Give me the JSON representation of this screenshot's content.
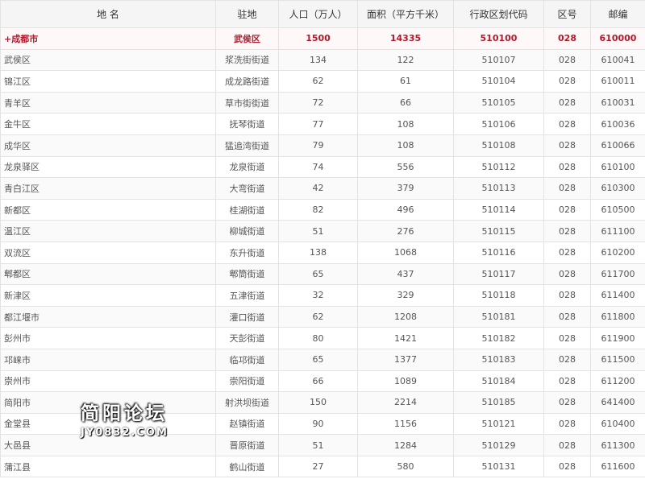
{
  "headers": [
    "地 名",
    "驻地",
    "人口（万人）",
    "面积（平方千米）",
    "行政区划代码",
    "区号",
    "邮编"
  ],
  "rows": [
    [
      "+成都市",
      "武侯区",
      "1500",
      "14335",
      "510100",
      "028",
      "610000"
    ],
    [
      "武侯区",
      "浆洗街街道",
      "134",
      "122",
      "510107",
      "028",
      "610041"
    ],
    [
      "锦江区",
      "成龙路街道",
      "62",
      "61",
      "510104",
      "028",
      "610011"
    ],
    [
      "青羊区",
      "草市街街道",
      "72",
      "66",
      "510105",
      "028",
      "610031"
    ],
    [
      "金牛区",
      "抚琴街道",
      "77",
      "108",
      "510106",
      "028",
      "610036"
    ],
    [
      "成华区",
      "猛追湾街道",
      "79",
      "108",
      "510108",
      "028",
      "610066"
    ],
    [
      "龙泉驿区",
      "龙泉街道",
      "74",
      "556",
      "510112",
      "028",
      "610100"
    ],
    [
      "青白江区",
      "大弯街道",
      "42",
      "379",
      "510113",
      "028",
      "610300"
    ],
    [
      "新都区",
      "桂湖街道",
      "82",
      "496",
      "510114",
      "028",
      "610500"
    ],
    [
      "温江区",
      "柳城街道",
      "51",
      "276",
      "510115",
      "028",
      "611100"
    ],
    [
      "双流区",
      "东升街道",
      "138",
      "1068",
      "510116",
      "028",
      "610200"
    ],
    [
      "郫都区",
      "郫筒街道",
      "65",
      "437",
      "510117",
      "028",
      "611700"
    ],
    [
      "新津区",
      "五津街道",
      "32",
      "329",
      "510118",
      "028",
      "611400"
    ],
    [
      "都江堰市",
      "灌口街道",
      "62",
      "1208",
      "510181",
      "028",
      "611800"
    ],
    [
      "彭州市",
      "天彭街道",
      "80",
      "1421",
      "510182",
      "028",
      "611900"
    ],
    [
      "邛崃市",
      "临邛街道",
      "65",
      "1377",
      "510183",
      "028",
      "611500"
    ],
    [
      "崇州市",
      "崇阳街道",
      "66",
      "1089",
      "510184",
      "028",
      "611200"
    ],
    [
      "简阳市",
      "射洪坝街道",
      "150",
      "2214",
      "510185",
      "028",
      "641400"
    ],
    [
      "金堂县",
      "赵镇街道",
      "90",
      "1156",
      "510121",
      "028",
      "610400"
    ],
    [
      "大邑县",
      "晋原街道",
      "51",
      "1284",
      "510129",
      "028",
      "611300"
    ],
    [
      "蒲江县",
      "鹤山街道",
      "27",
      "580",
      "510131",
      "028",
      "611600"
    ]
  ],
  "watermark": {
    "logo": "简阳论坛",
    "url": "JY0832.COM"
  }
}
